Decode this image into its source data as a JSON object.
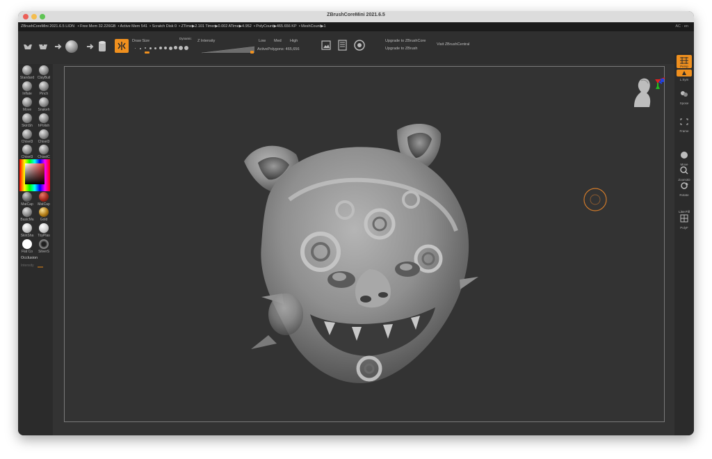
{
  "window": {
    "title": "ZBrushCoreMini 2021.6.5"
  },
  "infobar": {
    "app": "ZBrushCoreMini 2021.6.5 LION",
    "free_mem": "• Free Mem 32.226GB",
    "active_mem": "• Active Mem 541",
    "scratch_disk": "• Scratch Disk 0",
    "ztime": "• ZTime▶2.101 Timer▶0.002 ATime▶4.952",
    "polycount": "• PolyCount▶465.656 KP",
    "meshcount": "• MeshCount▶1",
    "right_label": "AC  ·  en"
  },
  "toolbar": {
    "draw_size_label": "Draw Size",
    "dynamic_label": "Dynamic",
    "z_intensity_label": "Z Intensity",
    "low_label": "Low",
    "med_label": "Med",
    "high_label": "High",
    "active_polygons": "ActivePolygons: 465,656",
    "upgrade_core": "Upgrade to ZBrushCore",
    "upgrade_zbrush": "Upgrade to ZBrush",
    "visit_central": "Visit ZBrushCentral"
  },
  "brushes": [
    {
      "label": "Standard"
    },
    {
      "label": "ClayBuil"
    },
    {
      "label": "Inflate"
    },
    {
      "label": "Pinch"
    },
    {
      "label": "Move"
    },
    {
      "label": "Snakeh"
    },
    {
      "label": "SkinSh"
    },
    {
      "label": "hPolish"
    },
    {
      "label": "Chisel3"
    },
    {
      "label": "Chisel3"
    },
    {
      "label": "Chisel3"
    },
    {
      "label": "ChiselC"
    }
  ],
  "materials": [
    {
      "label": "MatCap"
    },
    {
      "label": "MatCap"
    },
    {
      "label": "BasicMa"
    },
    {
      "label": "Gold"
    },
    {
      "label": "SkinSha"
    },
    {
      "label": "ToyPlas"
    },
    {
      "label": "Flat Co"
    },
    {
      "label": "SilverS"
    }
  ],
  "occlusion_label": "Occlusion",
  "intensity_label": "Intensity",
  "rightshelf": {
    "items": [
      {
        "label": "Persp"
      },
      {
        "label": "Floor"
      },
      {
        "label": "L.Sym"
      },
      {
        "label": "Xpose"
      },
      {
        "label": "Frame"
      },
      {
        "label": "Move"
      },
      {
        "label": "Zoom3D"
      },
      {
        "label": "Rotate"
      },
      {
        "label": "Line Fill"
      },
      {
        "label": "PolyF"
      }
    ]
  },
  "colors": {
    "accent": "#f0901e",
    "canvas_bg": "#333333",
    "panel_bg": "#2b2b2b"
  }
}
